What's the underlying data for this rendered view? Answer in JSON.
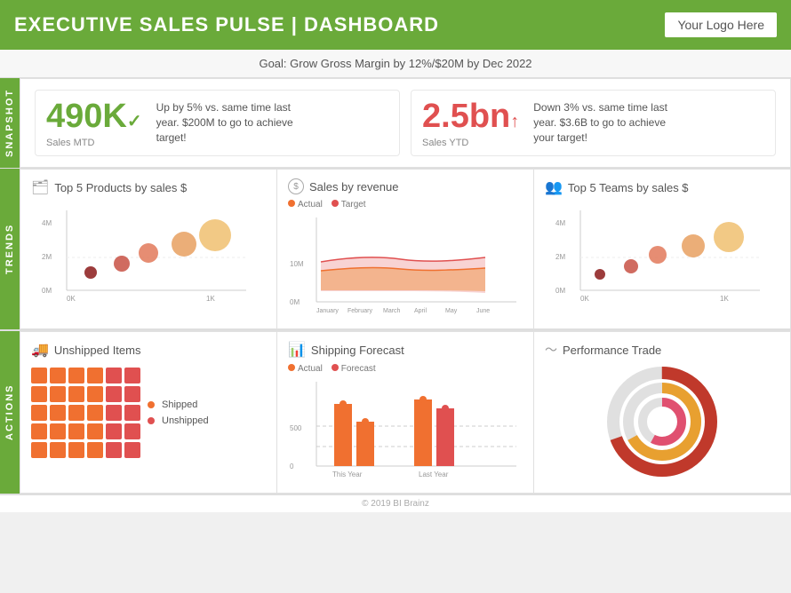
{
  "header": {
    "title": "EXECUTIVE SALES PULSE | DASHBOARD",
    "logo": "Your Logo Here"
  },
  "goal_bar": "Goal: Grow Gross Margin by 12%/$20M by Dec 2022",
  "snapshot": {
    "label": "SNAPSHOT",
    "card1": {
      "value": "490K",
      "suffix": "✓",
      "sub": "Sales MTD",
      "desc": "Up by 5% vs. same time last year. $200M to go to achieve target!"
    },
    "card2": {
      "value": "2.5bn",
      "suffix": "↑",
      "sub": "Sales YTD",
      "desc": "Down 3% vs. same time last year. $3.6B to go to achieve your target!"
    }
  },
  "trends": {
    "label": "TRENDS",
    "panel1": {
      "title": "Top 5 Products by sales $",
      "icon": "🗂"
    },
    "panel2": {
      "title": "Sales by revenue",
      "icon": "$",
      "legend": [
        "Actual",
        "Target"
      ]
    },
    "panel3": {
      "title": "Top 5 Teams by sales $",
      "icon": "👥"
    }
  },
  "actions": {
    "label": "ACTIONS",
    "panel1": {
      "title": "Unshipped Items",
      "icon": "🚚",
      "legend": [
        "Shipped",
        "Unshipped"
      ]
    },
    "panel2": {
      "title": "Shipping Forecast",
      "icon": "📊",
      "legend": [
        "Actual",
        "Forecast"
      ]
    },
    "panel3": {
      "title": "Performance Trade",
      "icon": "〜"
    }
  },
  "footer": "© 2019 BI Brainz"
}
